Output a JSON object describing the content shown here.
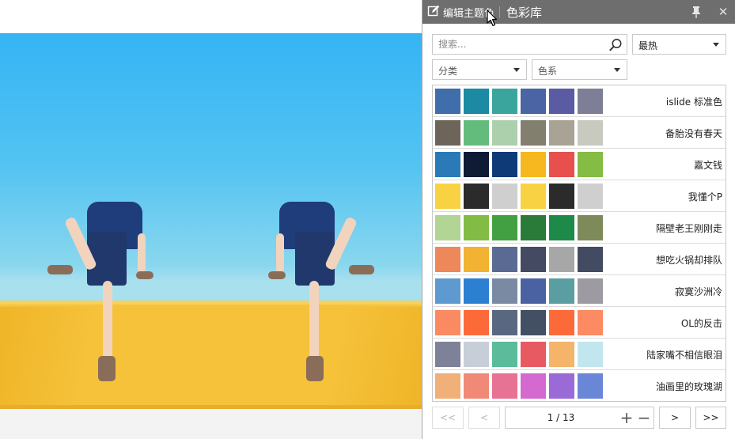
{
  "panel": {
    "edit_theme_label": "编辑主题色",
    "title": "色彩库",
    "icons": {
      "edit": "edit-icon",
      "pin": "pin-icon",
      "close": "close-icon",
      "search": "search-icon"
    }
  },
  "search": {
    "placeholder": "搜索...",
    "value": ""
  },
  "filters": {
    "sort": {
      "selected": "最热"
    },
    "category": {
      "selected": "分类"
    },
    "color_family": {
      "selected": "色系"
    }
  },
  "palettes": [
    {
      "name": "islide 标准色",
      "colors": [
        "#3f6eaa",
        "#1c8aa2",
        "#3aa59d",
        "#4a64a4",
        "#5a5ba2",
        "#7e7f96"
      ]
    },
    {
      "name": "备胎没有春天",
      "colors": [
        "#6e655a",
        "#64bc7c",
        "#acd0ac",
        "#827f6e",
        "#a8a395",
        "#c8c9bf"
      ]
    },
    {
      "name": "嘉文钱",
      "colors": [
        "#2a7ab8",
        "#0f1a35",
        "#0f3a78",
        "#f6b81e",
        "#e8504e",
        "#84bc44"
      ]
    },
    {
      "name": "我懂个P",
      "colors": [
        "#f8d242",
        "#2b2b2b",
        "#cfcfcf",
        "#f8d242",
        "#2b2b2b",
        "#cfcfcf"
      ]
    },
    {
      "name": "隔壁老王刚刚走",
      "colors": [
        "#b2d494",
        "#82bc44",
        "#42a042",
        "#2a7a3a",
        "#1e8a4a",
        "#7e8a5a"
      ]
    },
    {
      "name": "想吃火锅却排队",
      "colors": [
        "#ec885a",
        "#f2b232",
        "#5a6a92",
        "#434a62",
        "#a7a7a7",
        "#434b62"
      ]
    },
    {
      "name": "寂寞沙洲冷",
      "colors": [
        "#5e9ad0",
        "#2c80d2",
        "#7a8aa2",
        "#4a62a2",
        "#5a9ea2",
        "#9e9aa2"
      ]
    },
    {
      "name": "OL的反击",
      "colors": [
        "#fa8a62",
        "#fc6a3a",
        "#5a6780",
        "#434f62",
        "#fc6a3a",
        "#fc8a62"
      ]
    },
    {
      "name": "陆家嘴不相信眼泪",
      "colors": [
        "#7e8298",
        "#c8ced8",
        "#5abc9a",
        "#e85a62",
        "#f4b46a",
        "#c2e6ee"
      ]
    },
    {
      "name": "油画里的玫瑰湖",
      "colors": [
        "#f0b078",
        "#f08a76",
        "#e87294",
        "#d46ad0",
        "#9a6ad6",
        "#6a86d6"
      ]
    }
  ],
  "pager": {
    "first": "<<",
    "prev": "<",
    "indicator": "1 / 13",
    "zoom_in": "+",
    "zoom_out": "−",
    "next": ">",
    "last": ">>",
    "current_page": 1,
    "total_pages": 13
  },
  "colors": {
    "titlebar": "#6e6e6e",
    "sky": "#35b4f4",
    "wall": "#f5c23a"
  }
}
